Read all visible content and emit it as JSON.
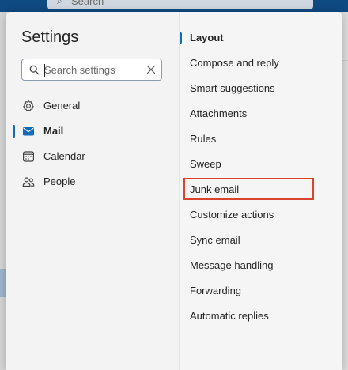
{
  "background": {
    "search_text": "Search"
  },
  "settings": {
    "title": "Settings",
    "search": {
      "placeholder": "Search settings",
      "value": ""
    },
    "nav": [
      {
        "label": "General",
        "icon": "gear-icon"
      },
      {
        "label": "Mail",
        "icon": "mail-icon",
        "selected": true
      },
      {
        "label": "Calendar",
        "icon": "calendar-icon"
      },
      {
        "label": "People",
        "icon": "people-icon"
      }
    ],
    "mail_sections": [
      {
        "label": "Layout",
        "selected": true
      },
      {
        "label": "Compose and reply"
      },
      {
        "label": "Smart suggestions"
      },
      {
        "label": "Attachments"
      },
      {
        "label": "Rules"
      },
      {
        "label": "Sweep"
      },
      {
        "label": "Junk email",
        "highlighted": true
      },
      {
        "label": "Customize actions"
      },
      {
        "label": "Sync email"
      },
      {
        "label": "Message handling"
      },
      {
        "label": "Forwarding"
      },
      {
        "label": "Automatic replies"
      }
    ]
  },
  "colors": {
    "accent": "#0f6cbd",
    "highlight": "#d9442f",
    "topbar": "#0f4a82"
  }
}
